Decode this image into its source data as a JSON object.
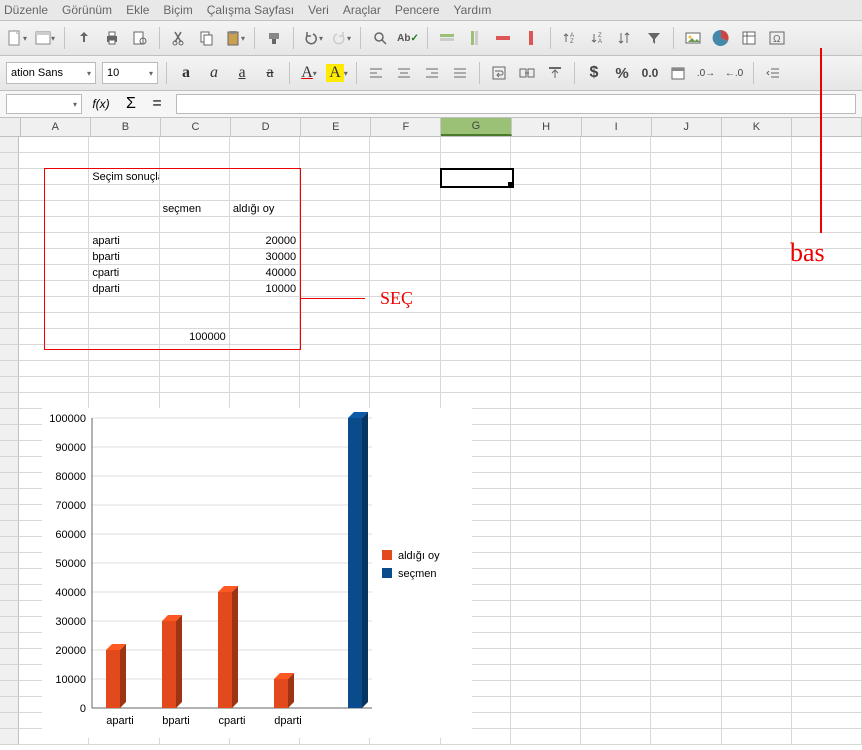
{
  "menu": [
    "Düzenle",
    "Görünüm",
    "Ekle",
    "Biçim",
    "Çalışma Sayfası",
    "Veri",
    "Araçlar",
    "Pencere",
    "Yardım"
  ],
  "toolbar_text": {
    "zero": "0.0"
  },
  "font": {
    "name": "ation Sans",
    "size": "10"
  },
  "columns": [
    "A",
    "B",
    "C",
    "D",
    "E",
    "F",
    "G",
    "H",
    "I",
    "J",
    "K"
  ],
  "active_col": "G",
  "cells": {
    "title": "Seçim sonuçları",
    "h1": "seçmen",
    "h2": "aldığı oy",
    "r1c1": "aparti",
    "r1c3": "20000",
    "r2c1": "bparti",
    "r2c3": "30000",
    "r3c1": "cparti",
    "r3c3": "40000",
    "r4c1": "dparti",
    "r4c3": "10000",
    "total": "100000"
  },
  "annotations": {
    "sec": "SEÇ",
    "bas": "bas"
  },
  "chart_data": {
    "type": "bar",
    "categories": [
      "aparti",
      "bparti",
      "cparti",
      "dparti",
      ""
    ],
    "series": [
      {
        "name": "aldığı oy",
        "color": "#e24a1d",
        "values": [
          20000,
          30000,
          40000,
          10000,
          0
        ]
      },
      {
        "name": "seçmen",
        "color": "#0a4b8c",
        "values": [
          0,
          0,
          0,
          0,
          100000
        ]
      }
    ],
    "ylim": [
      0,
      100000
    ],
    "yticks": [
      0,
      10000,
      20000,
      30000,
      40000,
      50000,
      60000,
      70000,
      80000,
      90000,
      100000
    ]
  }
}
